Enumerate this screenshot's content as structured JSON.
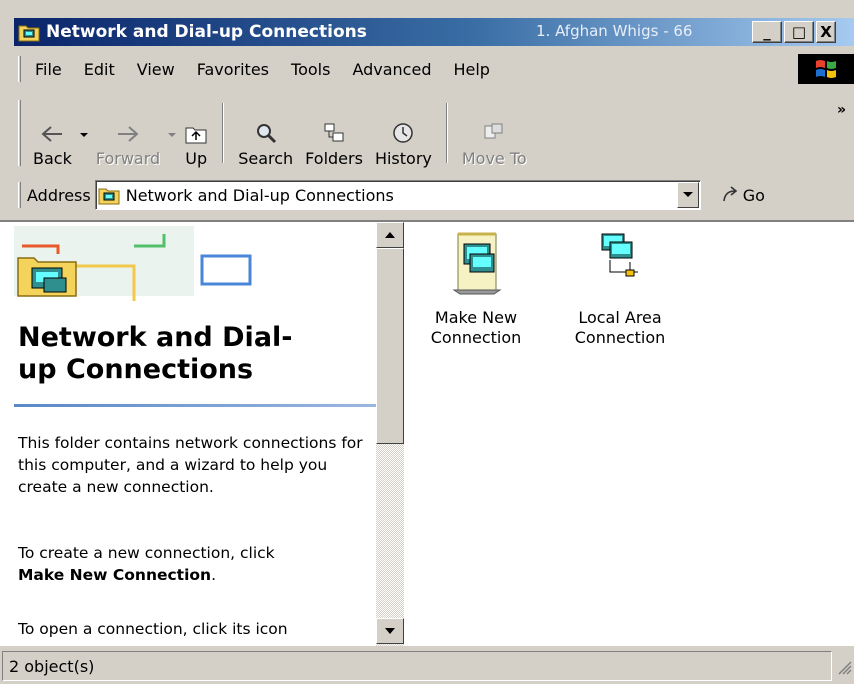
{
  "window": {
    "title": "Network and Dial-up Connections",
    "now_playing": "1. Afghan Whigs - 66",
    "minimize_label": "_",
    "maximize_label": "□",
    "close_label": "X"
  },
  "menu": [
    "File",
    "Edit",
    "View",
    "Favorites",
    "Tools",
    "Advanced",
    "Help"
  ],
  "toolbar": {
    "back": "Back",
    "forward": "Forward",
    "up": "Up",
    "search": "Search",
    "folders": "Folders",
    "history": "History",
    "move_to": "Move To",
    "more": "»"
  },
  "address": {
    "label": "Address",
    "value": "Network and Dial-up Connections",
    "go": "Go"
  },
  "left_pane": {
    "title_line1": "Network and Dial-",
    "title_line2": "up Connections",
    "para1": "This folder contains network connections for this computer, and a wizard to help you create a new connection.",
    "para2_prefix": "To create a new connection, click",
    "para2_bold": "Make New Connection",
    "para2_suffix": ".",
    "para3": "To open a connection, click its icon"
  },
  "items": [
    {
      "line1": "Make New",
      "line2": "Connection",
      "icon": "make-new-connection-icon"
    },
    {
      "line1": "Local Area",
      "line2": "Connection",
      "icon": "local-area-connection-icon"
    }
  ],
  "status": {
    "text": "2 object(s)"
  },
  "colors": {
    "title_active_start": "#0a246a",
    "title_active_end": "#a6caf0",
    "face": "#d4d0c8",
    "rule": "#5b88c6"
  }
}
